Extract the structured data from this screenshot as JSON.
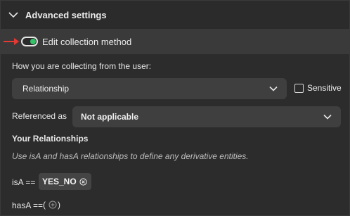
{
  "section": {
    "title": "Advanced settings",
    "expanded": true,
    "icon": "chevron-down-icon"
  },
  "toggle": {
    "label": "Edit collection method",
    "on": true,
    "on_color": "#35c46a",
    "annotation_arrow_color": "#e53935"
  },
  "collection": {
    "label": "How you are collecting from the user:",
    "method": "Relationship",
    "sensitive_label": "Sensitive",
    "sensitive_checked": false
  },
  "referenced": {
    "label": "Referenced as",
    "value": "Not applicable"
  },
  "relationships": {
    "heading": "Your Relationships",
    "description": "Use isA and hasA relationships to define any derivative entities.",
    "isa_label": "isA ==",
    "isa_chips": [
      "YES_NO"
    ],
    "hasa_label": "hasA ==",
    "hasa_open": "(",
    "hasa_close": ")"
  }
}
